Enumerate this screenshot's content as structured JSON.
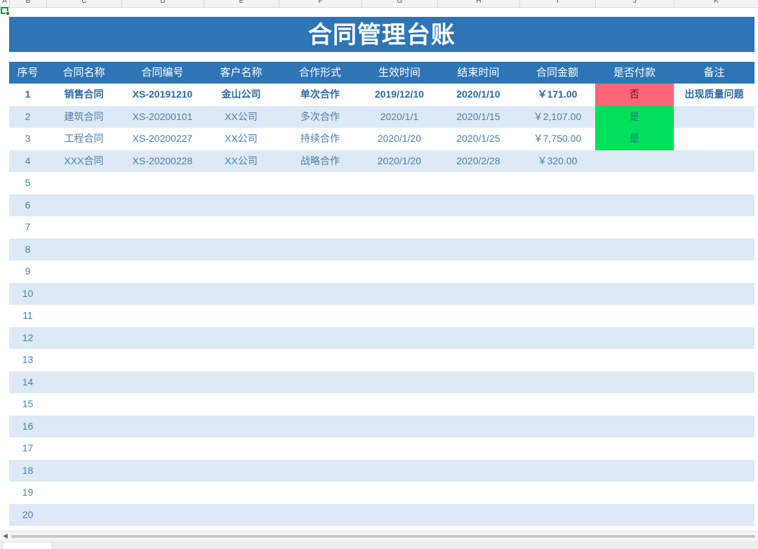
{
  "column_letters": [
    "A",
    "B",
    "C",
    "D",
    "E",
    "F",
    "G",
    "H",
    "I",
    "J",
    "K"
  ],
  "title": "合同管理台账",
  "headers": [
    "序号",
    "合同名称",
    "合同编号",
    "客户名称",
    "合作形式",
    "生效时间",
    "结束时间",
    "合同金额",
    "是否付款",
    "备注"
  ],
  "rows": [
    [
      "1",
      "销售合同",
      "XS-20191210",
      "金山公司",
      "单次合作",
      "2019/12/10",
      "2020/1/10",
      "￥171.00",
      "否",
      "出现质量问题"
    ],
    [
      "2",
      "建筑合同",
      "XS-20200101",
      "XX公司",
      "多次合作",
      "2020/1/1",
      "2020/1/15",
      "￥2,107.00",
      "是",
      ""
    ],
    [
      "3",
      "工程合同",
      "XS-20200227",
      "XX公司",
      "持续合作",
      "2020/1/20",
      "2020/1/25",
      "￥7,750.00",
      "是",
      ""
    ],
    [
      "4",
      "XXX合同",
      "XS-20200228",
      "XX公司",
      "战略合作",
      "2020/1/20",
      "2020/2/28",
      "￥320.00",
      "",
      ""
    ],
    [
      "5",
      "",
      "",
      "",
      "",
      "",
      "",
      "",
      "",
      ""
    ],
    [
      "6",
      "",
      "",
      "",
      "",
      "",
      "",
      "",
      "",
      ""
    ],
    [
      "7",
      "",
      "",
      "",
      "",
      "",
      "",
      "",
      "",
      ""
    ],
    [
      "8",
      "",
      "",
      "",
      "",
      "",
      "",
      "",
      "",
      ""
    ],
    [
      "9",
      "",
      "",
      "",
      "",
      "",
      "",
      "",
      "",
      ""
    ],
    [
      "10",
      "",
      "",
      "",
      "",
      "",
      "",
      "",
      "",
      ""
    ],
    [
      "11",
      "",
      "",
      "",
      "",
      "",
      "",
      "",
      "",
      ""
    ],
    [
      "12",
      "",
      "",
      "",
      "",
      "",
      "",
      "",
      "",
      ""
    ],
    [
      "13",
      "",
      "",
      "",
      "",
      "",
      "",
      "",
      "",
      ""
    ],
    [
      "14",
      "",
      "",
      "",
      "",
      "",
      "",
      "",
      "",
      ""
    ],
    [
      "15",
      "",
      "",
      "",
      "",
      "",
      "",
      "",
      "",
      ""
    ],
    [
      "16",
      "",
      "",
      "",
      "",
      "",
      "",
      "",
      "",
      ""
    ],
    [
      "17",
      "",
      "",
      "",
      "",
      "",
      "",
      "",
      "",
      ""
    ],
    [
      "18",
      "",
      "",
      "",
      "",
      "",
      "",
      "",
      "",
      ""
    ],
    [
      "19",
      "",
      "",
      "",
      "",
      "",
      "",
      "",
      "",
      ""
    ],
    [
      "20",
      "",
      "",
      "",
      "",
      "",
      "",
      "",
      "",
      ""
    ]
  ],
  "colors": {
    "header_bg": "#2e75b6",
    "band_bg": "#dde9f5",
    "text": "#4a7fb0",
    "payment_no": "#ff6578",
    "payment_yes": "#00e05a",
    "selection": "#1f8e3d"
  }
}
